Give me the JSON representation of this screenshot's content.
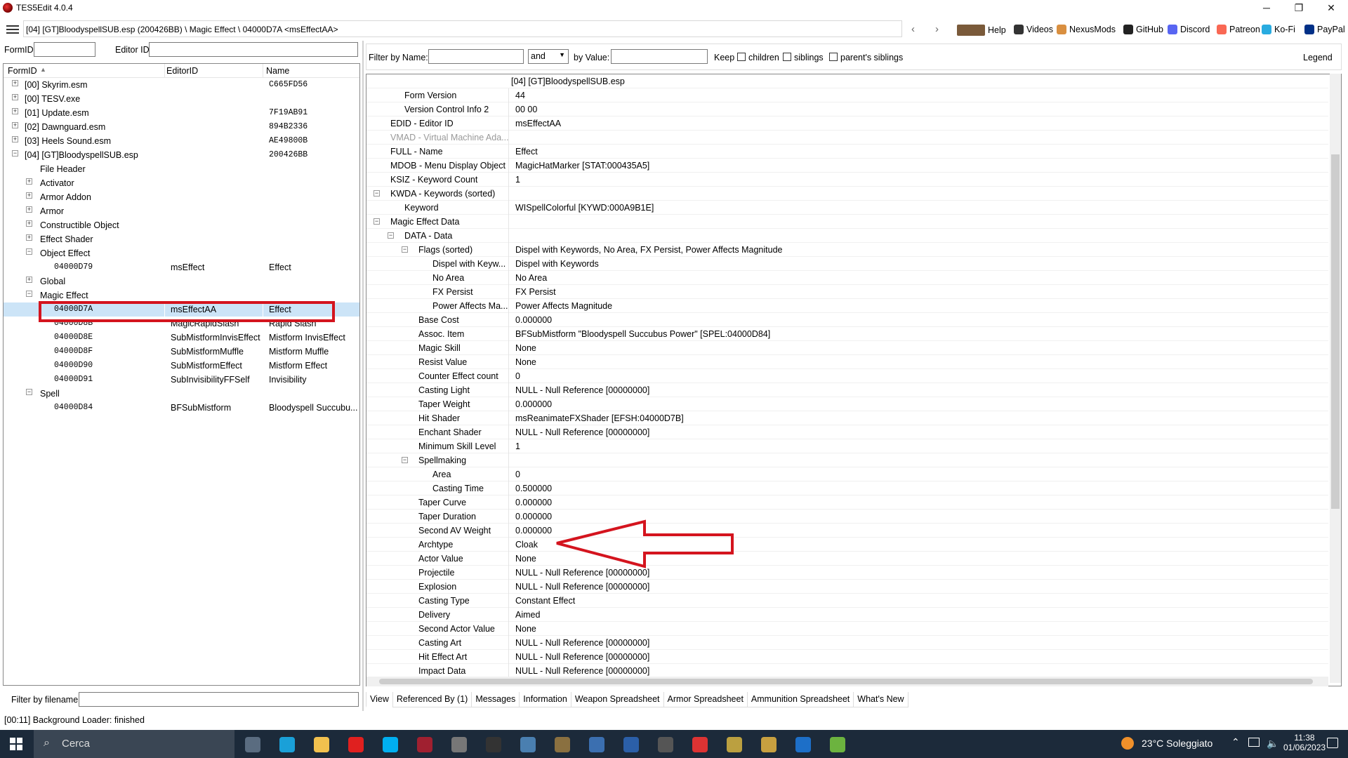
{
  "app": {
    "title": "TES5Edit 4.0.4"
  },
  "window_controls": {
    "minimize": "─",
    "maximize": "❐",
    "close": "✕"
  },
  "path": "[04] [GT]BloodyspellSUB.esp (200426BB) \\ Magic Effect \\ 04000D7A <msEffectAA>",
  "toolbar_links": [
    {
      "label": "Help",
      "icon": "book-icon",
      "color": "#7a5a3a"
    },
    {
      "label": "Videos",
      "icon": "videos-icon",
      "color": "#333"
    },
    {
      "label": "NexusMods",
      "icon": "nexusmods-icon",
      "color": "#d98f40"
    },
    {
      "label": "GitHub",
      "icon": "github-icon",
      "color": "#222"
    },
    {
      "label": "Discord",
      "icon": "discord-icon",
      "color": "#5865f2"
    },
    {
      "label": "Patreon",
      "icon": "patreon-icon",
      "color": "#f96854"
    },
    {
      "label": "Ko-Fi",
      "icon": "kofi-icon",
      "color": "#29abe0"
    },
    {
      "label": "PayPal",
      "icon": "paypal-icon",
      "color": "#003087"
    }
  ],
  "left_filter": {
    "formid_label": "FormID",
    "editorid_label": "Editor ID",
    "formid_value": "",
    "editorid_value": ""
  },
  "left_headers": {
    "formid": "FormID",
    "editorid": "EditorID",
    "name": "Name"
  },
  "tree": [
    {
      "indent": 0,
      "toggle": "+",
      "formid": "[00] Skyrim.esm",
      "editorid": "",
      "name": "C665FD56",
      "mono_name": true
    },
    {
      "indent": 0,
      "toggle": "+",
      "formid": "[00] TESV.exe",
      "editorid": "",
      "name": ""
    },
    {
      "indent": 0,
      "toggle": "+",
      "formid": "[01] Update.esm",
      "editorid": "",
      "name": "7F19AB91",
      "mono_name": true
    },
    {
      "indent": 0,
      "toggle": "+",
      "formid": "[02] Dawnguard.esm",
      "editorid": "",
      "name": "894B2336",
      "mono_name": true
    },
    {
      "indent": 0,
      "toggle": "+",
      "formid": "[03] Heels Sound.esm",
      "editorid": "",
      "name": "AE49800B",
      "mono_name": true
    },
    {
      "indent": 0,
      "toggle": "−",
      "formid": "[04] [GT]BloodyspellSUB.esp",
      "editorid": "",
      "name": "200426BB",
      "mono_name": true
    },
    {
      "indent": 1,
      "toggle": "",
      "formid": "File Header",
      "editorid": "",
      "name": ""
    },
    {
      "indent": 1,
      "toggle": "+",
      "formid": "Activator",
      "editorid": "",
      "name": ""
    },
    {
      "indent": 1,
      "toggle": "+",
      "formid": "Armor Addon",
      "editorid": "",
      "name": ""
    },
    {
      "indent": 1,
      "toggle": "+",
      "formid": "Armor",
      "editorid": "",
      "name": ""
    },
    {
      "indent": 1,
      "toggle": "+",
      "formid": "Constructible Object",
      "editorid": "",
      "name": ""
    },
    {
      "indent": 1,
      "toggle": "+",
      "formid": "Effect Shader",
      "editorid": "",
      "name": ""
    },
    {
      "indent": 1,
      "toggle": "−",
      "formid": "Object Effect",
      "editorid": "",
      "name": ""
    },
    {
      "indent": 2,
      "toggle": "",
      "formid": "04000D79",
      "editorid": "msEffect",
      "name": "Effect",
      "mono": true
    },
    {
      "indent": 1,
      "toggle": "+",
      "formid": "Global",
      "editorid": "",
      "name": ""
    },
    {
      "indent": 1,
      "toggle": "−",
      "formid": "Magic Effect",
      "editorid": "",
      "name": ""
    },
    {
      "indent": 2,
      "toggle": "",
      "formid": "04000D7A",
      "editorid": "msEffectAA",
      "name": "Effect",
      "mono": true,
      "selected": true
    },
    {
      "indent": 2,
      "toggle": "",
      "formid": "04000D8B",
      "editorid": "MagicRapidSlash",
      "name": "Rapid Slash",
      "mono": true
    },
    {
      "indent": 2,
      "toggle": "",
      "formid": "04000D8E",
      "editorid": "SubMistformInvisEffect",
      "name": "Mistform InvisEffect",
      "mono": true
    },
    {
      "indent": 2,
      "toggle": "",
      "formid": "04000D8F",
      "editorid": "SubMistformMuffle",
      "name": "Mistform Muffle",
      "mono": true
    },
    {
      "indent": 2,
      "toggle": "",
      "formid": "04000D90",
      "editorid": "SubMistformEffect",
      "name": "Mistform Effect",
      "mono": true
    },
    {
      "indent": 2,
      "toggle": "",
      "formid": "04000D91",
      "editorid": "SubInvisibilityFFSelf",
      "name": "Invisibility",
      "mono": true
    },
    {
      "indent": 1,
      "toggle": "−",
      "formid": "Spell",
      "editorid": "",
      "name": ""
    },
    {
      "indent": 2,
      "toggle": "",
      "formid": "04000D84",
      "editorid": "BFSubMistform",
      "name": "Bloodyspell Succubu...",
      "mono": true
    }
  ],
  "filename_filter": {
    "label": "Filter by filename:",
    "value": ""
  },
  "status": "[00:11] Background Loader: finished",
  "right_filter": {
    "name_label": "Filter by Name:",
    "name_value": "",
    "op": "and",
    "value_label": "by Value:",
    "value_value": "",
    "keep": "Keep",
    "children": "children",
    "siblings": "siblings",
    "parents": "parent's siblings",
    "legend": "Legend"
  },
  "record_header": "[04] [GT]BloodyspellSUB.esp",
  "records": [
    {
      "d": 1,
      "t": "",
      "k": "Form Version",
      "v": "44"
    },
    {
      "d": 1,
      "t": "",
      "k": "Version Control Info 2",
      "v": "00 00"
    },
    {
      "d": 0,
      "t": "",
      "k": "EDID - Editor ID",
      "v": "msEffectAA"
    },
    {
      "d": 0,
      "t": "",
      "k": "VMAD - Virtual Machine Ada...",
      "v": "",
      "gray": true
    },
    {
      "d": 0,
      "t": "",
      "k": "FULL - Name",
      "v": "Effect"
    },
    {
      "d": 0,
      "t": "",
      "k": "MDOB - Menu Display Object",
      "v": "MagicHatMarker [STAT:000435A5]"
    },
    {
      "d": 0,
      "t": "",
      "k": "KSIZ - Keyword Count",
      "v": "1"
    },
    {
      "d": 0,
      "t": "−",
      "k": "KWDA - Keywords (sorted)",
      "v": ""
    },
    {
      "d": 1,
      "t": "",
      "k": "Keyword",
      "v": "WISpellColorful [KYWD:000A9B1E]"
    },
    {
      "d": 0,
      "t": "−",
      "k": "Magic Effect Data",
      "v": ""
    },
    {
      "d": 1,
      "t": "−",
      "k": "DATA - Data",
      "v": ""
    },
    {
      "d": 2,
      "t": "−",
      "k": "Flags (sorted)",
      "v": "Dispel with Keywords, No Area, FX Persist, Power Affects Magnitude"
    },
    {
      "d": 3,
      "t": "",
      "k": "Dispel with Keyw...",
      "v": "Dispel with Keywords"
    },
    {
      "d": 3,
      "t": "",
      "k": "No Area",
      "v": "No Area"
    },
    {
      "d": 3,
      "t": "",
      "k": "FX Persist",
      "v": "FX Persist"
    },
    {
      "d": 3,
      "t": "",
      "k": "Power Affects Ma...",
      "v": "Power Affects Magnitude"
    },
    {
      "d": 2,
      "t": "",
      "k": "Base Cost",
      "v": "0.000000"
    },
    {
      "d": 2,
      "t": "",
      "k": "Assoc. Item",
      "v": "BFSubMistform \"Bloodyspell Succubus Power\" [SPEL:04000D84]"
    },
    {
      "d": 2,
      "t": "",
      "k": "Magic Skill",
      "v": "None"
    },
    {
      "d": 2,
      "t": "",
      "k": "Resist Value",
      "v": "None"
    },
    {
      "d": 2,
      "t": "",
      "k": "Counter Effect count",
      "v": "0"
    },
    {
      "d": 2,
      "t": "",
      "k": "Casting Light",
      "v": "NULL - Null Reference [00000000]"
    },
    {
      "d": 2,
      "t": "",
      "k": "Taper Weight",
      "v": "0.000000"
    },
    {
      "d": 2,
      "t": "",
      "k": "Hit Shader",
      "v": "msReanimateFXShader [EFSH:04000D7B]"
    },
    {
      "d": 2,
      "t": "",
      "k": "Enchant Shader",
      "v": "NULL - Null Reference [00000000]"
    },
    {
      "d": 2,
      "t": "",
      "k": "Minimum Skill Level",
      "v": "1"
    },
    {
      "d": 2,
      "t": "−",
      "k": "Spellmaking",
      "v": ""
    },
    {
      "d": 3,
      "t": "",
      "k": "Area",
      "v": "0"
    },
    {
      "d": 3,
      "t": "",
      "k": "Casting Time",
      "v": "0.500000"
    },
    {
      "d": 2,
      "t": "",
      "k": "Taper Curve",
      "v": "0.000000"
    },
    {
      "d": 2,
      "t": "",
      "k": "Taper Duration",
      "v": "0.000000"
    },
    {
      "d": 2,
      "t": "",
      "k": "Second AV Weight",
      "v": "0.000000"
    },
    {
      "d": 2,
      "t": "",
      "k": "Archtype",
      "v": "Cloak"
    },
    {
      "d": 2,
      "t": "",
      "k": "Actor Value",
      "v": "None"
    },
    {
      "d": 2,
      "t": "",
      "k": "Projectile",
      "v": "NULL - Null Reference [00000000]"
    },
    {
      "d": 2,
      "t": "",
      "k": "Explosion",
      "v": "NULL - Null Reference [00000000]"
    },
    {
      "d": 2,
      "t": "",
      "k": "Casting Type",
      "v": "Constant Effect"
    },
    {
      "d": 2,
      "t": "",
      "k": "Delivery",
      "v": "Aimed"
    },
    {
      "d": 2,
      "t": "",
      "k": "Second Actor Value",
      "v": "None"
    },
    {
      "d": 2,
      "t": "",
      "k": "Casting Art",
      "v": "NULL - Null Reference [00000000]"
    },
    {
      "d": 2,
      "t": "",
      "k": "Hit Effect Art",
      "v": "NULL - Null Reference [00000000]"
    },
    {
      "d": 2,
      "t": "",
      "k": "Impact Data",
      "v": "NULL - Null Reference [00000000]"
    }
  ],
  "tabs": [
    "View",
    "Referenced By (1)",
    "Messages",
    "Information",
    "Weapon Spreadsheet",
    "Armor Spreadsheet",
    "Ammunition Spreadsheet",
    "What's New"
  ],
  "taskbar": {
    "search": "Cerca",
    "weather": "23°C Soleggiato",
    "time": "11:38",
    "date": "01/06/2023",
    "apps": [
      {
        "icon": "task-view-icon",
        "color": "#5a6c80"
      },
      {
        "icon": "edge-icon",
        "color": "#1aa0d8"
      },
      {
        "icon": "file-explorer-icon",
        "color": "#f2c14e"
      },
      {
        "icon": "opera-icon",
        "color": "#e0201f"
      },
      {
        "icon": "skype-icon",
        "color": "#00aff0"
      },
      {
        "icon": "tes5edit-icon",
        "color": "#a02030"
      },
      {
        "icon": "app-icon",
        "color": "#777"
      },
      {
        "icon": "nvidia-icon",
        "color": "#333"
      },
      {
        "icon": "app-icon",
        "color": "#4a7fb0"
      },
      {
        "icon": "app-icon",
        "color": "#8a7040"
      },
      {
        "icon": "app-icon",
        "color": "#3b6fb0"
      },
      {
        "icon": "app-icon",
        "color": "#2b5fa8"
      },
      {
        "icon": "app-icon",
        "color": "#555"
      },
      {
        "icon": "app-icon",
        "color": "#d33"
      },
      {
        "icon": "app-icon",
        "color": "#bba040"
      },
      {
        "icon": "app-icon",
        "color": "#c8a040"
      },
      {
        "icon": "app-icon",
        "color": "#1d6fc8"
      },
      {
        "icon": "notepad-icon",
        "color": "#6cb33f"
      }
    ]
  },
  "annotation_color": "#d4141e"
}
